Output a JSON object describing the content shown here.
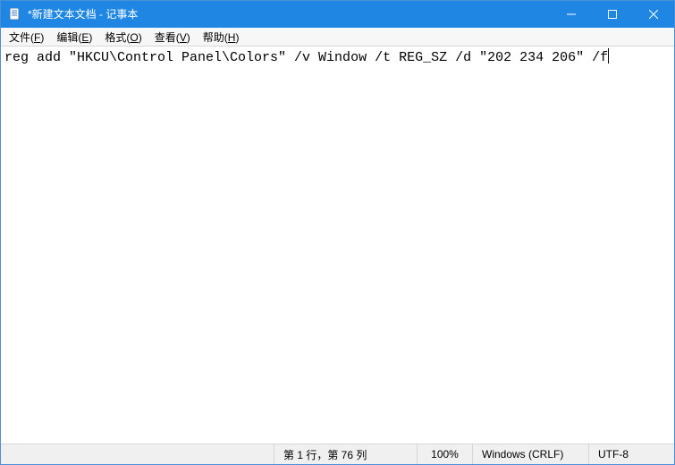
{
  "titlebar": {
    "title": "*新建文本文档 - 记事本"
  },
  "menubar": {
    "file": {
      "label": "文件",
      "hotkey": "F"
    },
    "edit": {
      "label": "编辑",
      "hotkey": "E"
    },
    "format": {
      "label": "格式",
      "hotkey": "O"
    },
    "view": {
      "label": "查看",
      "hotkey": "V"
    },
    "help": {
      "label": "帮助",
      "hotkey": "H"
    }
  },
  "editor": {
    "content": "reg add \"HKCU\\Control Panel\\Colors\" /v Window /t REG_SZ /d \"202 234 206\" /f"
  },
  "statusbar": {
    "position": "第 1 行，第 76 列",
    "zoom": "100%",
    "eol": "Windows (CRLF)",
    "encoding": "UTF-8"
  }
}
